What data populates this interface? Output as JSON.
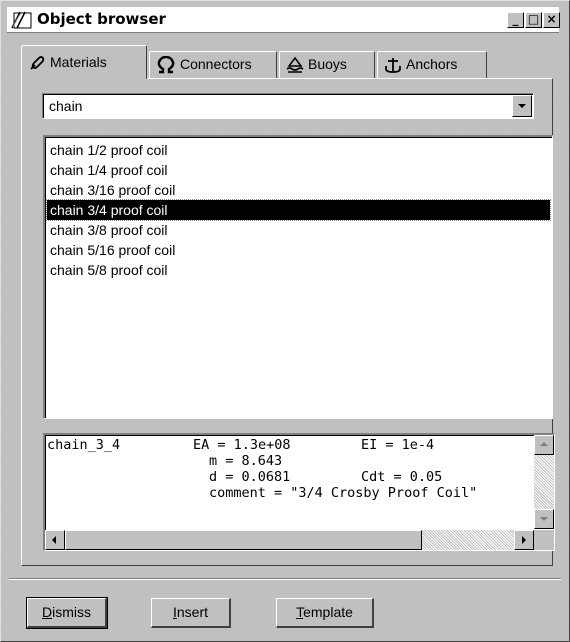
{
  "window": {
    "title": "Object browser",
    "controls": {
      "minimize": "_",
      "maximize": "□",
      "close": "×"
    }
  },
  "tabs": [
    {
      "label": "Materials",
      "icon": "chain-link-icon",
      "active": true
    },
    {
      "label": "Connectors",
      "icon": "omega-connector-icon",
      "active": false
    },
    {
      "label": "Buoys",
      "icon": "buoy-icon",
      "active": false
    },
    {
      "label": "Anchors",
      "icon": "anchor-icon",
      "active": false
    }
  ],
  "filter": {
    "value": "chain"
  },
  "list": {
    "items": [
      "chain 1/2 proof coil",
      "chain 1/4 proof coil",
      "chain 3/16 proof coil",
      "chain 3/4 proof coil",
      "chain 3/8 proof coil",
      "chain 5/16 proof coil",
      "chain 5/8 proof coil"
    ],
    "selected_index": 3
  },
  "details": {
    "name": "chain_3_4",
    "ea": "EA = 1.3e+08",
    "ei": "EI = 1e-4",
    "m": "m = 8.643",
    "d": "d = 0.0681",
    "cdt": "Cdt = 0.05",
    "comment": "comment = \"3/4 Crosby Proof Coil\""
  },
  "buttons": {
    "dismiss": {
      "key": "D",
      "rest": "ismiss"
    },
    "insert": {
      "key": "I",
      "rest": "nsert"
    },
    "template": {
      "key": "T",
      "rest": "emplate"
    }
  },
  "colors": {
    "face": "#c0c0c0",
    "selection": "#000000",
    "field": "#ffffff"
  }
}
